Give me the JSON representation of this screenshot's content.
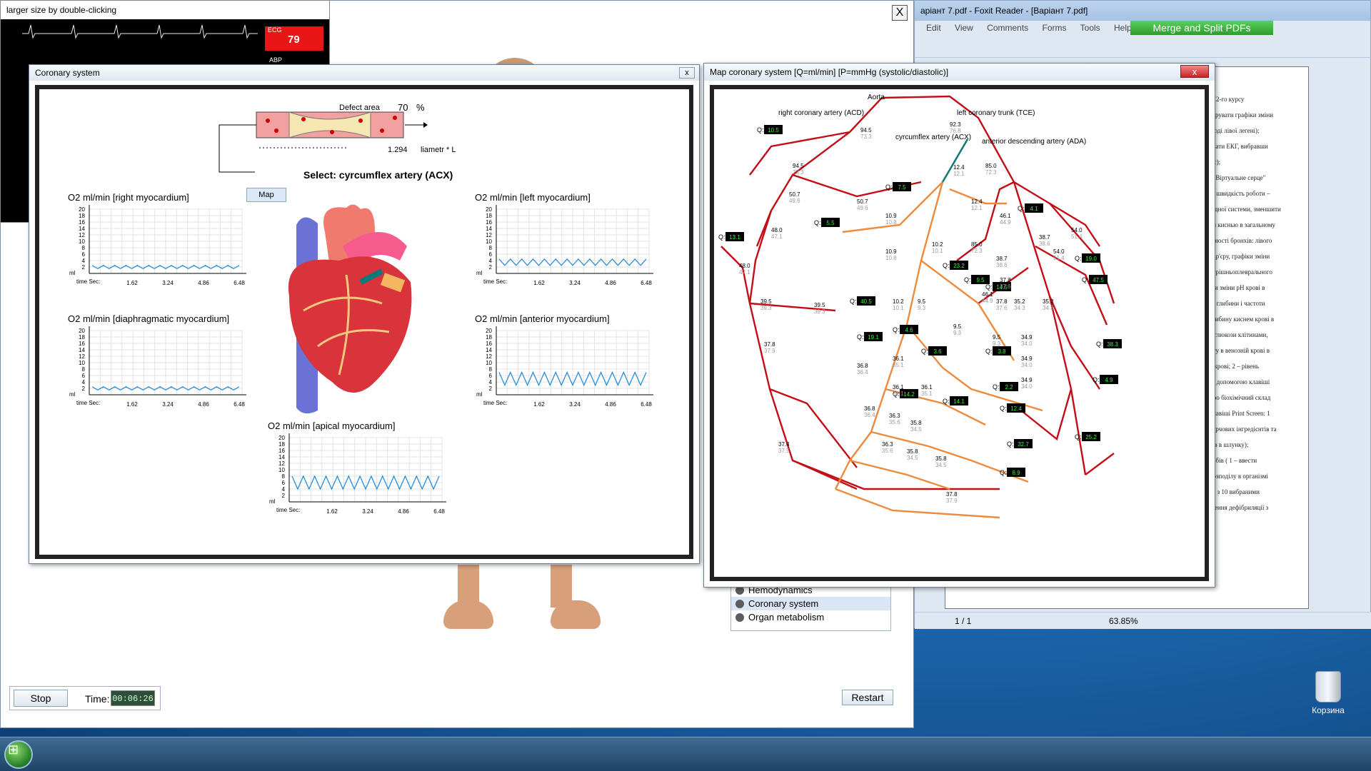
{
  "monitor": {
    "title": "larger size by double-clicking",
    "ecg_label": "ECG",
    "ecg_value": "79",
    "abp_label": "ABP"
  },
  "main": {
    "close_label": "X",
    "menu_items": [
      "Hemodynamics",
      "Coronary system",
      "Organ metabolism"
    ],
    "stop_label": "Stop",
    "time_label": "Time:",
    "time_value": "00:06:26",
    "restart_label": "Restart"
  },
  "coronary": {
    "title": "Coronary system",
    "close_label": "x",
    "defect_label": "Defect area",
    "defect_value": "70",
    "defect_unit": "%",
    "diam_value": "1.294",
    "diam_label": "liametr * L",
    "select_text": "Select: cyrcumflex artery (ACX)",
    "map_button": "Map"
  },
  "charts": {
    "yticks": [
      "20",
      "18",
      "16",
      "14",
      "12",
      "10",
      "8",
      "6",
      "4",
      "2"
    ],
    "ylabel": "ml",
    "xlabel": "time Sec:",
    "xticks": [
      "1.62",
      "3.24",
      "4.86",
      "6.48"
    ],
    "right": "O2 ml/min [right myocardium]",
    "left": "O2 ml/min [left myocardium]",
    "diaph": "O2 ml/min [diaphragmatic myocardium]",
    "anterior": "O2 ml/min [anterior myocardium]",
    "apical": "O2 ml/min [apical myocardium]",
    "color_line": "#2a8fd6"
  },
  "chart_data": [
    {
      "type": "line",
      "title": "O2 ml/min [right myocardium]",
      "ylim": [
        0,
        20
      ],
      "xticks": [
        1.62,
        3.24,
        4.86,
        6.48
      ],
      "amplitude": [
        1.5,
        2.5
      ]
    },
    {
      "type": "line",
      "title": "O2 ml/min [left myocardium]",
      "ylim": [
        0,
        20
      ],
      "xticks": [
        1.62,
        3.24,
        4.86,
        6.48
      ],
      "amplitude": [
        2.5,
        4.5
      ]
    },
    {
      "type": "line",
      "title": "O2 ml/min [diaphragmatic myocardium]",
      "ylim": [
        0,
        20
      ],
      "xticks": [
        1.62,
        3.24,
        4.86,
        6.48
      ],
      "amplitude": [
        1.5,
        2.5
      ]
    },
    {
      "type": "line",
      "title": "O2 ml/min [anterior myocardium]",
      "ylim": [
        0,
        20
      ],
      "xticks": [
        1.62,
        3.24,
        4.86,
        6.48
      ],
      "amplitude": [
        3,
        7
      ]
    },
    {
      "type": "line",
      "title": "O2 ml/min [apical myocardium]",
      "ylim": [
        0,
        20
      ],
      "xticks": [
        1.62,
        3.24,
        4.86,
        6.48
      ],
      "amplitude": [
        4,
        8
      ]
    }
  ],
  "map": {
    "title": "Map coronary system     [Q=ml/min]    [P=mmHg (systolic/diastolic)]",
    "close_label": "x",
    "aorta": "Aorta",
    "acd": "right coronary artery (ACD)",
    "tce": "left coronary trunk (TCE)",
    "acx": "cyrcumflex artery (ACX)",
    "ada": "anterior descending artery (ADA)",
    "q_boxes": [
      "10.5",
      "7.5",
      "5.5",
      "13.1",
      "40.5",
      "19.1",
      "4.6",
      "3.6",
      "14.2",
      "14.1",
      "23.2",
      "9.5",
      "14.5",
      "4.1",
      "19.0",
      "47.5",
      "38.3",
      "4.9",
      "3.8",
      "2.2",
      "12.4",
      "32.7",
      "25.2",
      "8.9"
    ],
    "pressures": [
      [
        "94.5",
        "73.3"
      ],
      [
        "92.3",
        "76.8"
      ],
      [
        "94.5",
        "73.3"
      ],
      [
        "50.7",
        "49.6"
      ],
      [
        "50.7",
        "49.6"
      ],
      [
        "12.4",
        "12.1"
      ],
      [
        "85.0",
        "72.3"
      ],
      [
        "12.4",
        "12.1"
      ],
      [
        "48.0",
        "47.1"
      ],
      [
        "10.9",
        "10.8"
      ],
      [
        "54.0",
        "51.4"
      ],
      [
        "46.1",
        "44.9"
      ],
      [
        "85.0",
        "72.3"
      ],
      [
        "10.9",
        "10.8"
      ],
      [
        "10.2",
        "10.1"
      ],
      [
        "38.7",
        "38.6"
      ],
      [
        "38.7",
        "38.6"
      ],
      [
        "54.0",
        "51.4"
      ],
      [
        "48.0",
        "47.1"
      ],
      [
        "37.8",
        "37.6"
      ],
      [
        "46.1",
        "44.9"
      ],
      [
        "37.8",
        "37.6"
      ],
      [
        "39.5",
        "39.3"
      ],
      [
        "39.5",
        "39.3"
      ],
      [
        "10.2",
        "10.1"
      ],
      [
        "9.5",
        "9.3"
      ],
      [
        "35.2",
        "34.3"
      ],
      [
        "35.2",
        "34.3"
      ],
      [
        "37.8",
        "37.9"
      ],
      [
        "9.5",
        "9.3"
      ],
      [
        "9.5",
        "9.3"
      ],
      [
        "34.9",
        "34.0"
      ],
      [
        "34.9",
        "34.0"
      ],
      [
        "36.1",
        "35.1"
      ],
      [
        "36.8",
        "36.4"
      ],
      [
        "34.9",
        "34.0"
      ],
      [
        "36.1",
        "35.1"
      ],
      [
        "36.1",
        "35.1"
      ],
      [
        "36.8",
        "36.4"
      ],
      [
        "36.3",
        "35.6"
      ],
      [
        "35.8",
        "34.5"
      ],
      [
        "37.4",
        "37.5"
      ],
      [
        "36.3",
        "35.6"
      ],
      [
        "35.8",
        "34.5"
      ],
      [
        "35.8",
        "34.5"
      ],
      [
        "37.8",
        "37.9"
      ]
    ],
    "color_main": "#c40e16",
    "color_branch": "#ee8a3c",
    "color_selected": "#0a7a7a"
  },
  "foxit": {
    "title": "аріант 7.pdf - Foxit Reader - [Варіант 7.pdf]",
    "menu": [
      "Edit",
      "View",
      "Comments",
      "Forms",
      "Tools",
      "Help"
    ],
    "merge": "Merge and Split PDFs",
    "page": "1 / 1",
    "zoom": "63.85%",
    "pdf_lines": [
      "ів 2-го курсу",
      "струвати графіки зміни",
      "іводі лівої легені);",
      "увати ЕКГ, вибравши",
      "мс);",
      "і \"Віртуальне серце\"",
      "и, швидкість роботи –",
      "оїдної системи, зменшити",
      "ня киснью в загальному",
      "ідності бронхів: лівого",
      "бар'єру, графіки зміни",
      "утрішньоплеврального",
      "іки зміни рН крові в",
      "ні глибини і частоти",
      "глибину киснем крові в",
      "я глюкози клітинами,",
      "нту в венозній крові в",
      "в крові; 2 – рівень",
      "за допомогою клавіші",
      "про біохімічний склад",
      "клавіші Print Screen:  1",
      "харчових інгредієнтів та",
      "тів в шлунку);",
      "собів  ( 1 – ввести",
      "розподілу в організмі",
      "фі з 10 вибраними",
      "ілення дефібриляції з"
    ]
  },
  "desktop": {
    "trash_label": "Корзина"
  }
}
